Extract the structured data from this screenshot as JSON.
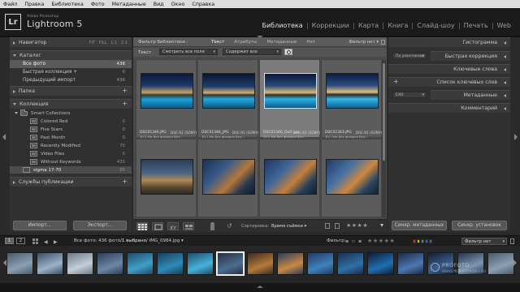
{
  "menu": [
    "Файл",
    "Правка",
    "Библиотека",
    "Фото",
    "Метаданные",
    "Вид",
    "Окно",
    "Справка"
  ],
  "identity": {
    "logo": "Lr",
    "sub": "Adobe Photoshop",
    "title": "Lightroom 5"
  },
  "modules": [
    "Библиотека",
    "Коррекции",
    "Карта",
    "Книга",
    "Слайд-шоу",
    "Печать",
    "Web"
  ],
  "left": {
    "navigator": {
      "label": "Навигатор",
      "zoom": "FIT  FILL  1:1  2:1"
    },
    "catalog": {
      "label": "Каталог",
      "items": [
        {
          "label": "Все фото",
          "count": "436"
        },
        {
          "label": "Быстрая коллекция +",
          "count": "0"
        },
        {
          "label": "Предыдущий импорт",
          "count": "436"
        }
      ]
    },
    "folders": {
      "label": "Папка"
    },
    "collections": {
      "label": "Коллекция",
      "items": [
        {
          "label": "Smart Collections",
          "count": ""
        },
        {
          "label": "Colored Red",
          "count": "0"
        },
        {
          "label": "Five Stars",
          "count": "0"
        },
        {
          "label": "Past Month",
          "count": "0"
        },
        {
          "label": "Recently Modified",
          "count": "70"
        },
        {
          "label": "Video Files",
          "count": "0"
        },
        {
          "label": "Without Keywords",
          "count": "435"
        },
        {
          "label": "sigma 17-70",
          "count": "85"
        }
      ]
    },
    "publish": {
      "label": "Службы публикации"
    },
    "import_btn": "Импорт...",
    "export_btn": "Экспорт..."
  },
  "center": {
    "filter_title": "Фильтр библиотеки :",
    "filter_tabs": [
      "Текст",
      "Атрибуты",
      "Метаданные",
      "Нет"
    ],
    "filter_preset": "Фильтр нет ▾",
    "text_label": "Текст",
    "text_field": "Смотреть все поля",
    "text_rule": "Содержит все",
    "cells": [
      {
        "fn": "DSC01346.JPG",
        "meta": "70.1 Мп   Без флажка  Без...",
        "cam": "DSC-R1 (SONY)"
      },
      {
        "fn": "DSC01346_JPG",
        "meta": "70.1 Мп   Без флажка  Без...",
        "cam": "DSC-R1 (SONY)"
      },
      {
        "fn": "DSC01346_DxO.jpg",
        "meta": "70.1 Мп   Без флажка  Без...",
        "cam": "DSC-R1 (SONY)"
      },
      {
        "fn": "DSC01343.JPG",
        "meta": "70.1 Мп   Без флажка  Без...",
        "cam": "DSC-R1 (SONY)"
      }
    ],
    "sort_label": "Сортировка:",
    "sort_value": "Время съёмки ▾",
    "stars": "★★★★"
  },
  "right": {
    "histogram": "Гистограмма",
    "quick_develop": "Быстрая коррекция",
    "qd_preset": "По умолчанию",
    "keywording": "Ключевые слова",
    "keyword_list": "Список ключевых слов",
    "metadata": "Метаданные",
    "meta_preset": "EXIF",
    "comments": "Комментарий",
    "sync_meta_btn": "Синхр. метаданных",
    "sync_settings_btn": "Синхр. установок"
  },
  "filmstrip": {
    "pages": [
      "1",
      "2"
    ],
    "info_prefix": "Все фото",
    "info_text": ": 436 фото/",
    "info_sel": "1 выбрано",
    "info_file": "/ IMG_0984.jpg ▾",
    "filter_label": "Фильтр:",
    "filter_preset": "Фильтр нет",
    "stars": "★★★★★",
    "watermark_1": "PROFOTO",
    "watermark_2": "WWW.PROFOTOVIDEO.RU"
  },
  "colors": {
    "label_red": "#c0392b",
    "label_yellow": "#c8b73a",
    "label_green": "#4a9a3b",
    "label_blue": "#3a5fae",
    "label_purple": "#7a4a9a"
  }
}
